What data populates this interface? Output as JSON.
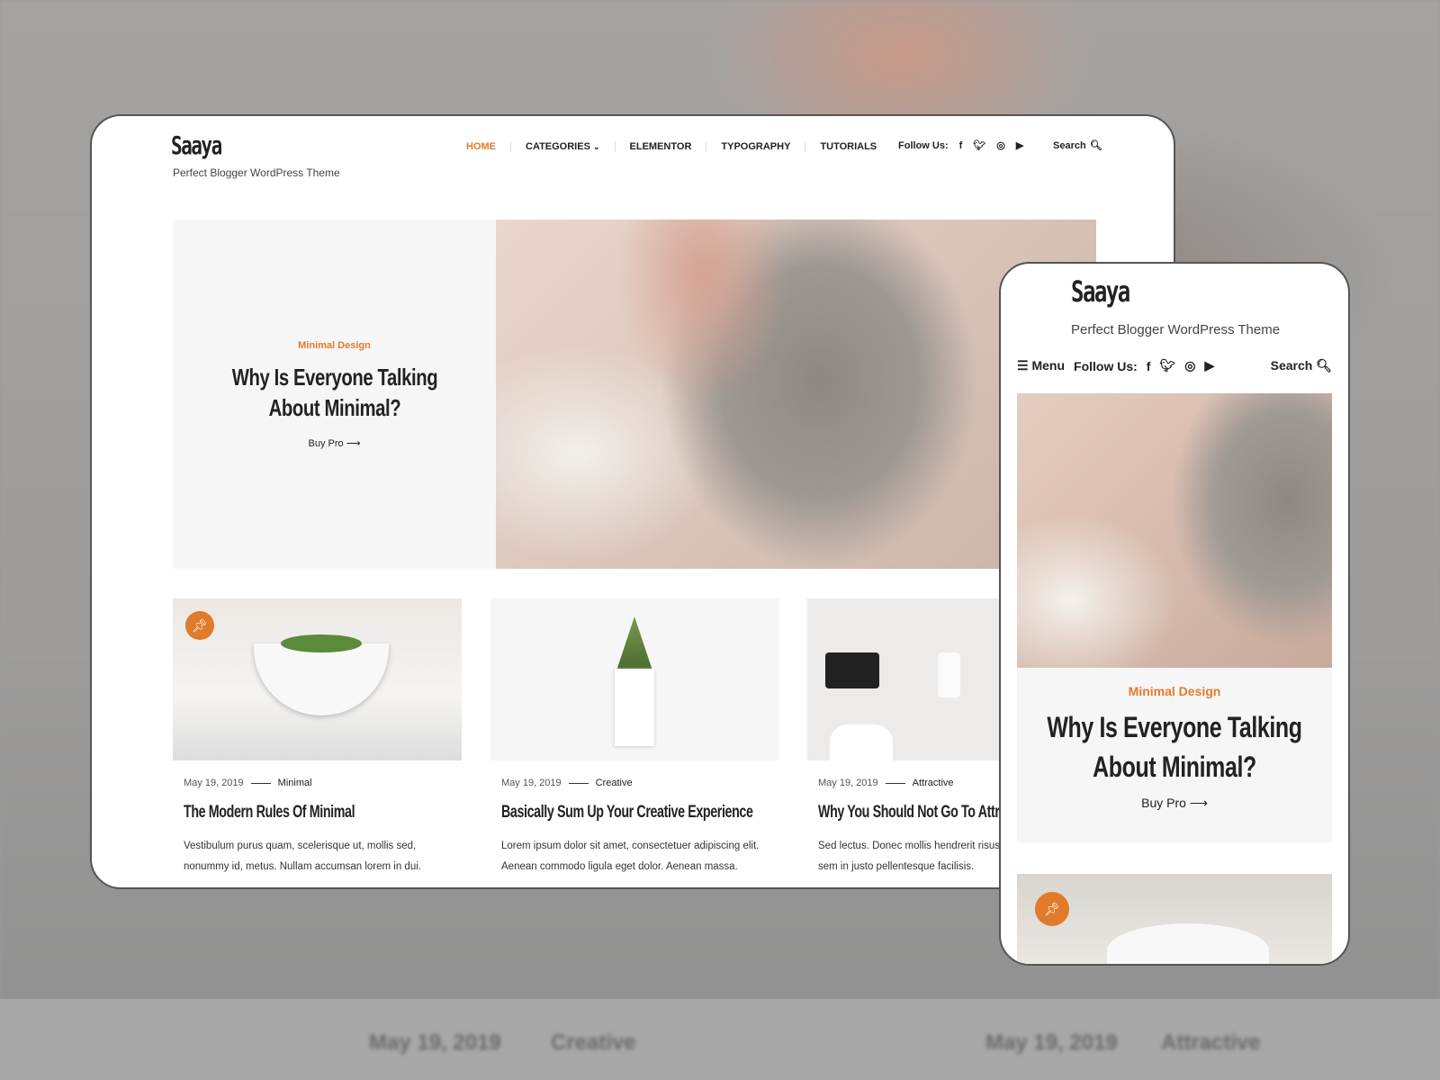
{
  "brand": {
    "logo": "Saaya",
    "tagline": "Perfect Blogger WordPress Theme",
    "accent": "#e07b2b"
  },
  "nav": {
    "items": [
      "HOME",
      "CATEGORIES",
      "ELEMENTOR",
      "TYPOGRAPHY",
      "TUTORIALS"
    ],
    "active": "HOME"
  },
  "follow": {
    "label": "Follow Us:",
    "icons": [
      "facebook-icon",
      "twitter-icon",
      "instagram-icon",
      "youtube-icon"
    ]
  },
  "search": {
    "label": "Search"
  },
  "hero": {
    "category": "Minimal Design",
    "title": "Why Is Everyone Talking About Minimal?",
    "cta": "Buy Pro"
  },
  "posts": [
    {
      "date": "May 19, 2019",
      "category": "Minimal",
      "title": "The Modern Rules Of Minimal",
      "excerpt1": "Vestibulum purus quam, scelerisque ut, mollis sed,",
      "excerpt2": "nonummy id, metus. Nullam accumsan lorem in dui.",
      "pinned": true
    },
    {
      "date": "May 19, 2019",
      "category": "Creative",
      "title": "Basically Sum Up Your Creative Experience",
      "excerpt1": "Lorem ipsum dolor sit amet, consectetuer adipiscing elit.",
      "excerpt2": "Aenean commodo ligula eget dolor. Aenean massa."
    },
    {
      "date": "May 19, 2019",
      "category": "Attractive",
      "title": "Why You Should Not Go To Attractive",
      "excerpt1": "Sed lectus. Donec mollis hendrerit risus",
      "excerpt2": "sem in justo pellentesque facilisis."
    }
  ],
  "mobile": {
    "menu": "Menu"
  }
}
